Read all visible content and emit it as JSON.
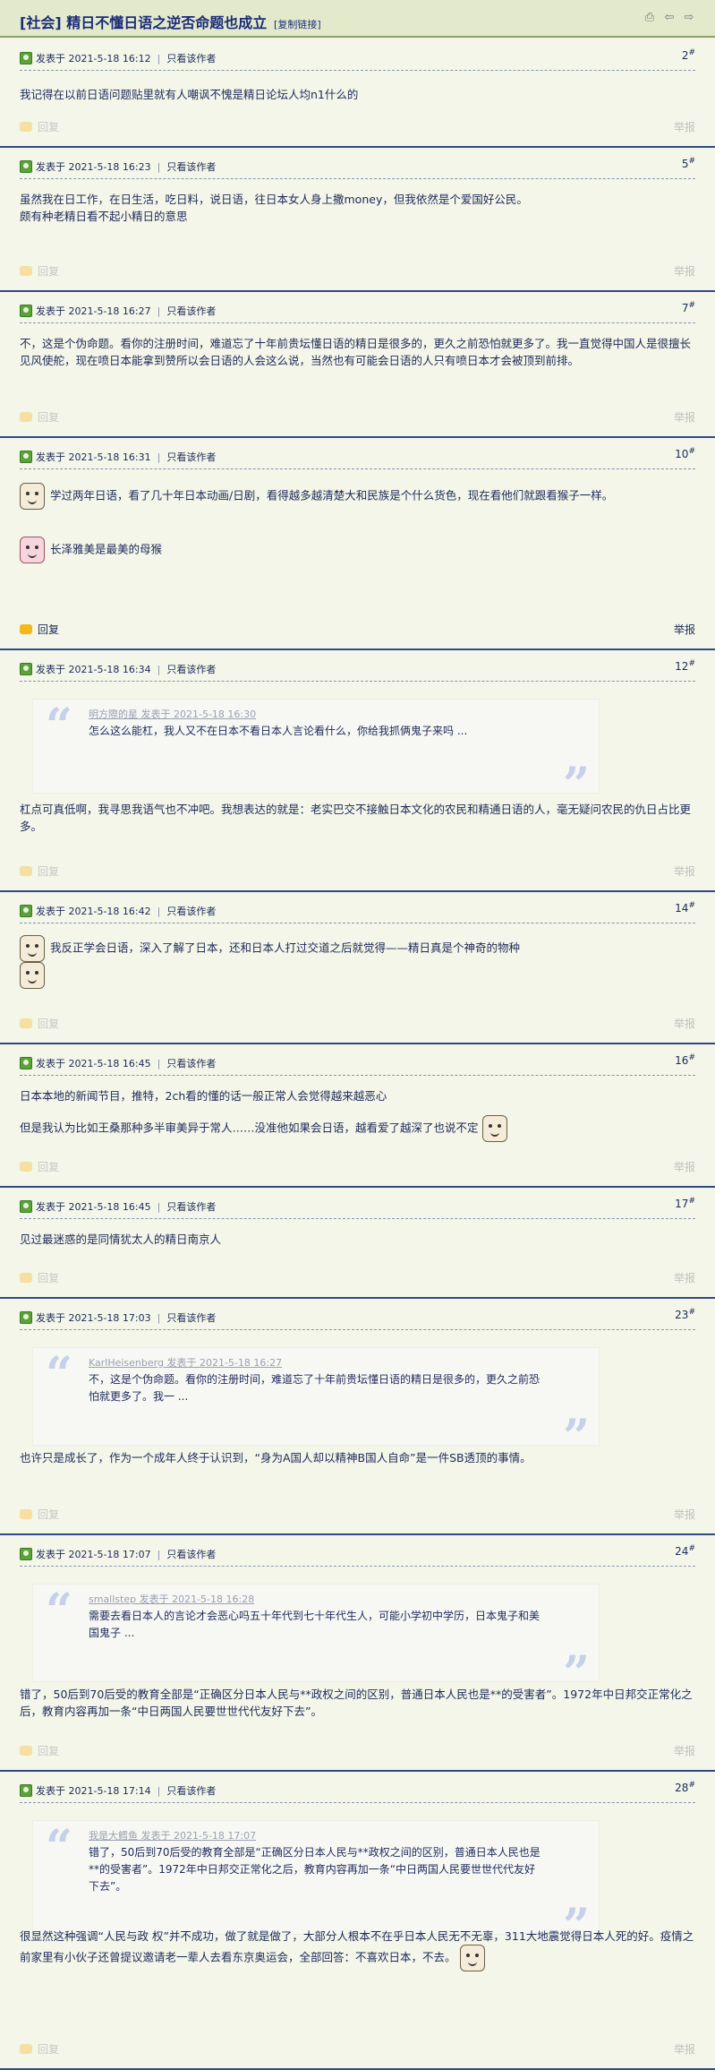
{
  "header": {
    "title": "[社会] 精日不懂日语之逆否命题也成立",
    "copy_link": "[复制链接]"
  },
  "labels": {
    "posted_at": "发表于",
    "only_author": "只看该作者",
    "reply": "回复",
    "report": "举报"
  },
  "posts": [
    {
      "time": "2021-5-18 16:12",
      "floor": "2",
      "text": [
        "我记得在以前日语问题贴里就有人嘲讽不愧是精日论坛人均n1什么的"
      ]
    },
    {
      "time": "2021-5-18 16:23",
      "floor": "5",
      "text": [
        "虽然我在日工作，在日生活，吃日料，说日语，往日本女人身上撒money，但我依然是个爱国好公民。",
        "颇有种老精日看不起小精日的意思"
      ]
    },
    {
      "time": "2021-5-18 16:27",
      "floor": "7",
      "text": [
        "不，这是个伪命题。看你的注册时间，难道忘了十年前贵坛懂日语的精日是很多的，更久之前恐怕就更多了。我一直觉得中国人是很擅长见风使舵，现在喷日本能拿到赞所以会日语的人会这么说，当然也有可能会日语的人只有喷日本才会被顶到前排。"
      ]
    },
    {
      "time": "2021-5-18 16:31",
      "floor": "10",
      "text": [
        "学过两年日语，看了几十年日本动画/日剧，看得越多越清楚大和民族是个什么货色，现在看他们就跟看猴子一样。",
        "长泽雅美是最美的母猴"
      ]
    },
    {
      "time": "2021-5-18 16:34",
      "floor": "12",
      "quote_author": "明方際的星 发表于 2021-5-18 16:30",
      "quote_text": "怎么这么能杠，我人又不在日本不看日本人言论看什么，你给我抓俩鬼子来吗 ...",
      "text": [
        "杠点可真低啊，我寻思我语气也不冲吧。我想表达的就是：老实巴交不接触日本文化的农民和精通日语的人，毫无疑问农民的仇日占比更多。"
      ]
    },
    {
      "time": "2021-5-18 16:42",
      "floor": "14",
      "text": [
        "我反正学会日语，深入了解了日本，还和日本人打过交道之后就觉得——精日真是个神奇的物种"
      ]
    },
    {
      "time": "2021-5-18 16:45",
      "floor": "16",
      "text": [
        "日本本地的新闻节目，推特，2ch看的懂的话一般正常人会觉得越来越恶心",
        "但是我认为比如王桑那种多半审美异于常人……没准他如果会日语，越看爱了越深了也说不定"
      ]
    },
    {
      "time": "2021-5-18 16:45",
      "floor": "17",
      "text": [
        "见过最迷惑的是同情犹太人的精日南京人"
      ]
    },
    {
      "time": "2021-5-18 17:03",
      "floor": "23",
      "quote_author": "KarlHeisenberg 发表于 2021-5-18 16:27",
      "quote_text": "不，这是个伪命题。看你的注册时间，难道忘了十年前贵坛懂日语的精日是很多的，更久之前恐怕就更多了。我一 ...",
      "text": [
        "也许只是成长了，作为一个成年人终于认识到，“身为A国人却以精神B国人自命”是一件SB透顶的事情。"
      ]
    },
    {
      "time": "2021-5-18 17:07",
      "floor": "24",
      "quote_author": "smallstep 发表于 2021-5-18 16:28",
      "quote_text": "需要去看日本人的言论才会恶心吗五十年代到七十年代生人，可能小学初中学历，日本鬼子和美国鬼子 ...",
      "text": [
        "错了，50后到70后受的教育全部是“正确区分日本人民与**政权之间的区别，普通日本人民也是**的受害者”。1972年中日邦交正常化之后，教育内容再加一条“中日两国人民要世世代代友好下去”。"
      ]
    },
    {
      "time": "2021-5-18 17:14",
      "floor": "28",
      "quote_author": "我是大鳕鱼 发表于 2021-5-18 17:07",
      "quote_text": "错了，50后到70后受的教育全部是“正确区分日本人民与**政权之间的区别，普通日本人民也是**的受害者”。1972年中日邦交正常化之后，教育内容再加一条“中日两国人民要世世代代友好下去”。",
      "text": [
        "很显然这种强调“人民与政 权”并不成功，做了就是做了，大部分人根本不在乎日本人民无不无辜，311大地震觉得日本人死的好。疫情之前家里有小伙子还曾提议邀请老一辈人去看东京奥运会，全部回答：不喜欢日本，不去。"
      ]
    }
  ]
}
